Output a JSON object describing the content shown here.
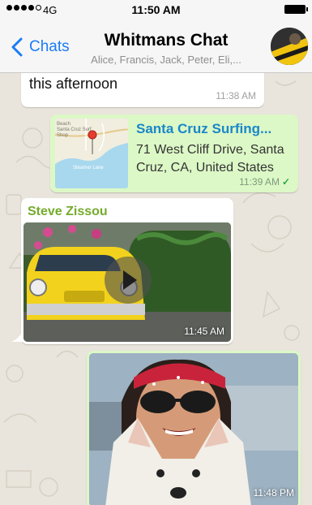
{
  "status_bar": {
    "carrier": "4G",
    "time": "11:50 AM"
  },
  "nav": {
    "back_label": "Chats",
    "title": "Whitmans Chat",
    "subtitle": "Alice, Francis, Jack, Peter, Eli,..."
  },
  "messages": [
    {
      "direction": "incoming",
      "text": "Nice! I definitely feel like surfing this afternoon",
      "time": "11:38 AM"
    },
    {
      "direction": "outgoing",
      "type": "location",
      "title": "Santa Cruz Surfing...",
      "address": "71 West Cliff Drive, Santa Cruz, CA, United States",
      "time": "11:39 AM",
      "status_icon": "check-icon",
      "map_labels": [
        "Beach",
        "Santa Cruz Surf",
        "Shop",
        "Steamer Lane"
      ]
    },
    {
      "direction": "incoming",
      "type": "video",
      "sender": "Steve Zissou",
      "time": "11:45 AM",
      "icon": "play-icon"
    },
    {
      "direction": "outgoing",
      "type": "photo",
      "time": "11:48 PM"
    }
  ],
  "colors": {
    "accent_blue": "#1a7cf6",
    "outgoing_bubble": "#dcf8c6",
    "incoming_bubble": "#ffffff",
    "sender_green": "#74ab2b",
    "link_blue": "#1a87c9",
    "chat_background": "#e9e4dc"
  }
}
